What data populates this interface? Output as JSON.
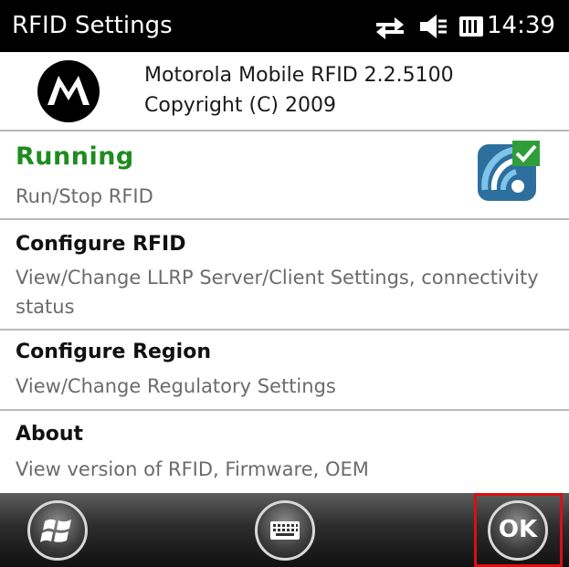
{
  "status_bar": {
    "title": "RFID Settings",
    "time": "14:39",
    "icons": [
      "connectivity-icon",
      "volume-muted-icon",
      "battery-icon"
    ]
  },
  "header": {
    "line1": "Motorola Mobile RFID 2.2.5100",
    "line2": "Copyright (C) 2009",
    "logo_icon": "motorola-logo"
  },
  "items": [
    {
      "title": "Running",
      "subtitle": "Run/Stop RFID",
      "title_color": "#1f8c1f",
      "icon": "rfid-running-check-icon"
    },
    {
      "title": "Configure RFID",
      "subtitle": "View/Change LLRP Server/Client Settings, connectivity status"
    },
    {
      "title": "Configure Region",
      "subtitle": "View/Change Regulatory Settings"
    },
    {
      "title": "About",
      "subtitle": "View version of RFID, Firmware, OEM"
    }
  ],
  "bottom_bar": {
    "start_icon": "windows-start-icon",
    "keyboard_icon": "keyboard-icon",
    "ok_label": "OK",
    "ok_highlight_color": "#d81010"
  }
}
